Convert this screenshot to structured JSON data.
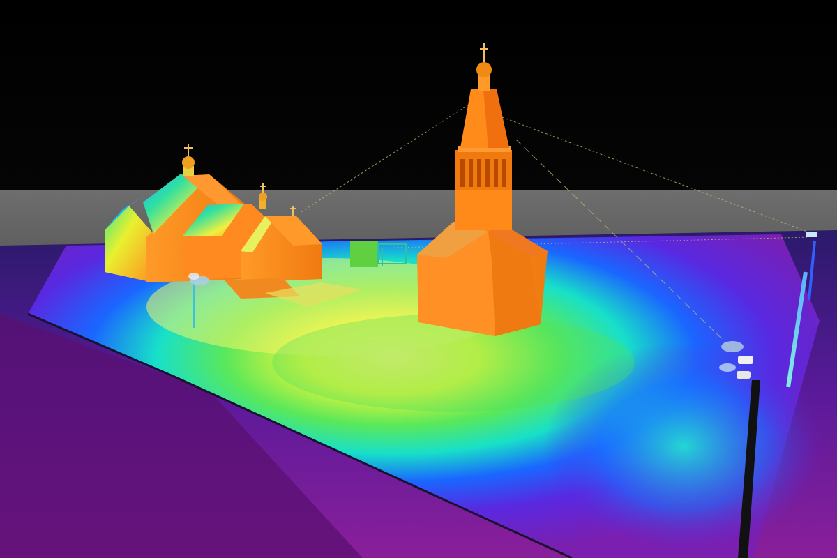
{
  "viewport": {
    "description_visible_text": "",
    "colors": {
      "sky": "#000000",
      "horizon_band": "#6f6f6f",
      "ground_far": "#3b1a78",
      "ground_near": "#7a1fa0",
      "heat_low": "#5a1ed8",
      "heat_mid_low": "#1a66ff",
      "heat_mid": "#18e0e0",
      "heat_mid_high": "#34e06a",
      "heat_high": "#d8f030",
      "heat_peak": "#fff070",
      "building_lit": "#ff8c1a",
      "building_shade": "#f06a00",
      "pole_dark": "#111111",
      "pole_light": "#7adcf0",
      "beam_line": "#b8b060"
    }
  },
  "scene_objects": [
    {
      "name": "bell-tower-church",
      "kind": "building"
    },
    {
      "name": "main-church",
      "kind": "building"
    },
    {
      "name": "small-chapel",
      "kind": "building"
    },
    {
      "name": "small-pavilion",
      "kind": "structure"
    },
    {
      "name": "floodlight-pole-left",
      "kind": "light"
    },
    {
      "name": "floodlight-pole-right-near",
      "kind": "light"
    },
    {
      "name": "floodlight-pole-right-far",
      "kind": "light"
    }
  ]
}
